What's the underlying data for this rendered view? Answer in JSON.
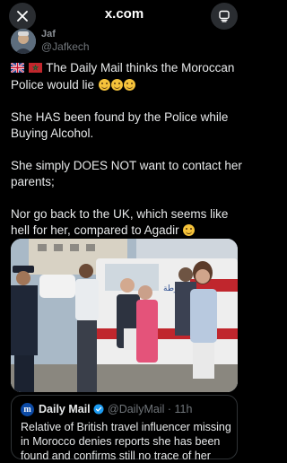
{
  "browser": {
    "url": "x.com",
    "close_icon": "close-icon",
    "tabs_icon": "tabs-icon"
  },
  "post": {
    "display_name": "Jaf",
    "handle": "@Jafkech",
    "paragraphs": [
      "The Daily Mail thinks the Moroccan Police would lie",
      "She HAS been found by the Police while Buying Alcohol.",
      "She simply DOES NOT want to contact her parents;",
      "Nor go back to the UK, which seems like hell for her, compared to Agadir"
    ],
    "flags": [
      "uk-flag-icon",
      "morocco-flag-icon"
    ],
    "emojis": [
      "laughing-emoji",
      "laughing-emoji",
      "laughing-emoji",
      "smile-emoji"
    ]
  },
  "photo": {
    "van_text": "الشرطة",
    "alt_icon": "photo-police-scene"
  },
  "quote": {
    "name": "Daily Mail",
    "handle_time": "@DailyMail · 11h",
    "text": "Relative of British travel influencer missing in Morocco denies reports she has been found and confirms still no trace of her",
    "logo_letter": "m"
  }
}
